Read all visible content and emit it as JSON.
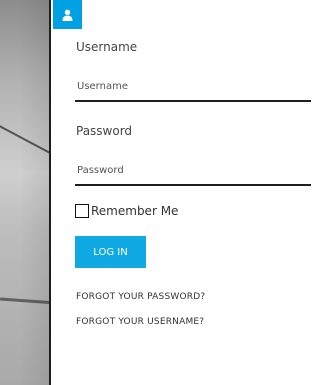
{
  "form": {
    "username_label": "Username",
    "username_placeholder": "Username",
    "password_label": "Password",
    "password_placeholder": "Password",
    "remember_label": "Remember Me",
    "login_label": "LOG IN",
    "forgot_password_label": "FORGOT YOUR PASSWORD?",
    "forgot_username_label": "FORGOT YOUR USERNAME?"
  },
  "colors": {
    "accent": "#00a0e3",
    "button": "#11a9e4"
  },
  "icons": {
    "user_tab": "user-icon"
  }
}
